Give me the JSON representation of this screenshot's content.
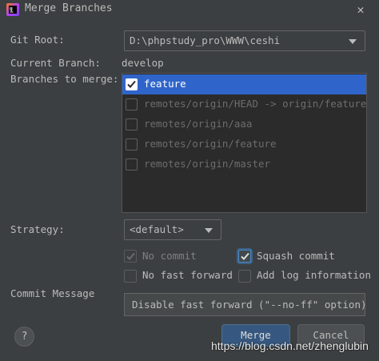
{
  "window": {
    "title": "Merge Branches",
    "close_icon": "close-icon",
    "app_icon": "intellij-app-icon"
  },
  "form": {
    "git_root_label": "Git Root:",
    "git_root_value": "D:\\phpstudy_pro\\WWW\\ceshi",
    "current_branch_label": "Current Branch:",
    "current_branch_value": "develop",
    "branches_label": "Branches to merge:",
    "branches": [
      {
        "label": "feature",
        "checked": true,
        "selected": true
      },
      {
        "label": "remotes/origin/HEAD -> origin/feature",
        "checked": false,
        "selected": false
      },
      {
        "label": "remotes/origin/aaa",
        "checked": false,
        "selected": false
      },
      {
        "label": "remotes/origin/feature",
        "checked": false,
        "selected": false
      },
      {
        "label": "remotes/origin/master",
        "checked": false,
        "selected": false
      }
    ],
    "strategy_label": "Strategy:",
    "strategy_value": "<default>",
    "options": {
      "no_commit": {
        "label": "No commit",
        "checked": true,
        "enabled": false
      },
      "squash_commit": {
        "label": "Squash commit",
        "checked": true,
        "enabled": true
      },
      "no_fast_forward": {
        "label": "No fast forward",
        "checked": false,
        "enabled": true
      },
      "add_log_information": {
        "label": "Add log information",
        "checked": false,
        "enabled": true
      }
    },
    "commit_message_label": "Commit Message",
    "commit_message_value": "Disable fast forward (\"--no-ff\" option)"
  },
  "footer": {
    "help_label": "?",
    "merge_label": "Merge",
    "cancel_label": "Cancel"
  },
  "watermark": "https://blog.csdn.net/zhenglubin",
  "colors": {
    "background": "#3c3f41",
    "selection": "#2f65ca",
    "default_button": "#365880"
  }
}
